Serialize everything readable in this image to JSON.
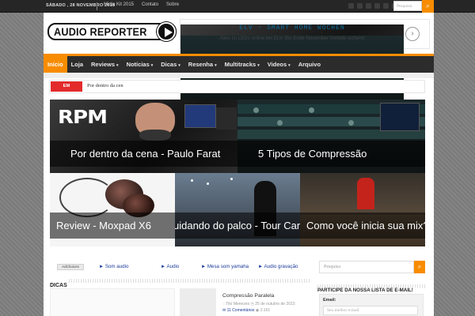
{
  "topbar": {
    "date": "SÁBADO , 28 NOVEMBRO 2015",
    "links": [
      "Midia Kit 2015",
      "Contato",
      "Sobre"
    ],
    "search_placeholder": "Pesquisa"
  },
  "header": {
    "logo_text": "AUDIO REPORTER",
    "ad": {
      "title": "ELV - SMART HOME WOCHEN",
      "subtitle": "Alles zu LEDs online bei ELV. Bis Ende November Vorteile sichern!"
    }
  },
  "nav": {
    "items": [
      {
        "label": "Início",
        "caret": false
      },
      {
        "label": "Loja",
        "caret": false
      },
      {
        "label": "Reviews",
        "caret": true
      },
      {
        "label": "Notícias",
        "caret": true
      },
      {
        "label": "Dicas",
        "caret": true
      },
      {
        "label": "Resenha",
        "caret": true
      },
      {
        "label": "Multitracks",
        "caret": true
      },
      {
        "label": "Videos",
        "caret": true
      },
      {
        "label": "Arquivo",
        "caret": false
      }
    ],
    "caret_glyph": "▾"
  },
  "breaking": {
    "label": "EM DESTAQUE",
    "item": "Por dentro da cen"
  },
  "slider": {
    "logo_text": "RPM",
    "tiles": [
      {
        "caption": "Por dentro da cena - Paulo Farat"
      },
      {
        "caption": "5 Tipos de Compressão"
      },
      {
        "caption": "Review - Moxpad X6"
      },
      {
        "caption": "uidando do palco - Tour Carbono Leni"
      },
      {
        "caption": "Como você inicia sua mix?"
      }
    ]
  },
  "adlinks": {
    "adchoices": "AdChoices",
    "links": [
      "► Som audio",
      "► Audio",
      "► Mesa som yamaha",
      "► Audio gravação"
    ]
  },
  "sidebar": {
    "search_placeholder": "Pesquisa",
    "search_icon": "search-icon",
    "newsletter_title": "PARTICIPE DA NOSSA LISTA DE E-MAIL!",
    "email_label": "Email:",
    "email_placeholder": "Seu melhor e-mail"
  },
  "dicas": {
    "heading": "DICAS",
    "post_title": "Compressão Paralela",
    "author": "Tito Menezes",
    "date": "25 de outubro de 2015",
    "comments": "11 Comentários",
    "views": "2.161"
  },
  "colors": {
    "accent": "#f88c00",
    "breaking": "#e32b2b",
    "nav_bg": "#2c2c2c"
  }
}
